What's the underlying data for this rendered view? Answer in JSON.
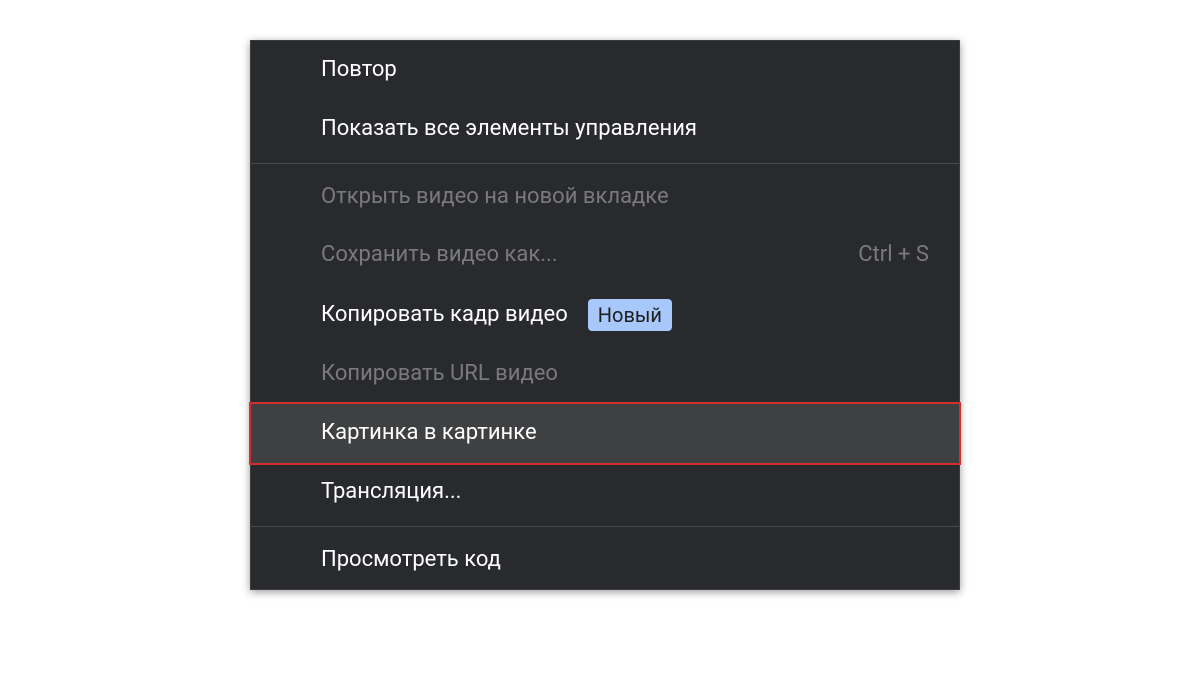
{
  "menu": {
    "sections": [
      {
        "items": [
          {
            "label": "Повтор",
            "enabled": true
          },
          {
            "label": "Показать все элементы управления",
            "enabled": true
          }
        ]
      },
      {
        "items": [
          {
            "label": "Открыть видео на новой вкладке",
            "enabled": false
          },
          {
            "label": "Сохранить видео как...",
            "enabled": false,
            "shortcut": "Ctrl + S"
          },
          {
            "label": "Копировать кадр видео",
            "enabled": true,
            "badge": "Новый"
          },
          {
            "label": "Копировать URL видео",
            "enabled": false
          },
          {
            "label": "Картинка в картинке",
            "enabled": true,
            "highlighted": true
          },
          {
            "label": "Трансляция...",
            "enabled": true
          }
        ]
      },
      {
        "items": [
          {
            "label": "Просмотреть код",
            "enabled": true
          }
        ]
      }
    ]
  }
}
